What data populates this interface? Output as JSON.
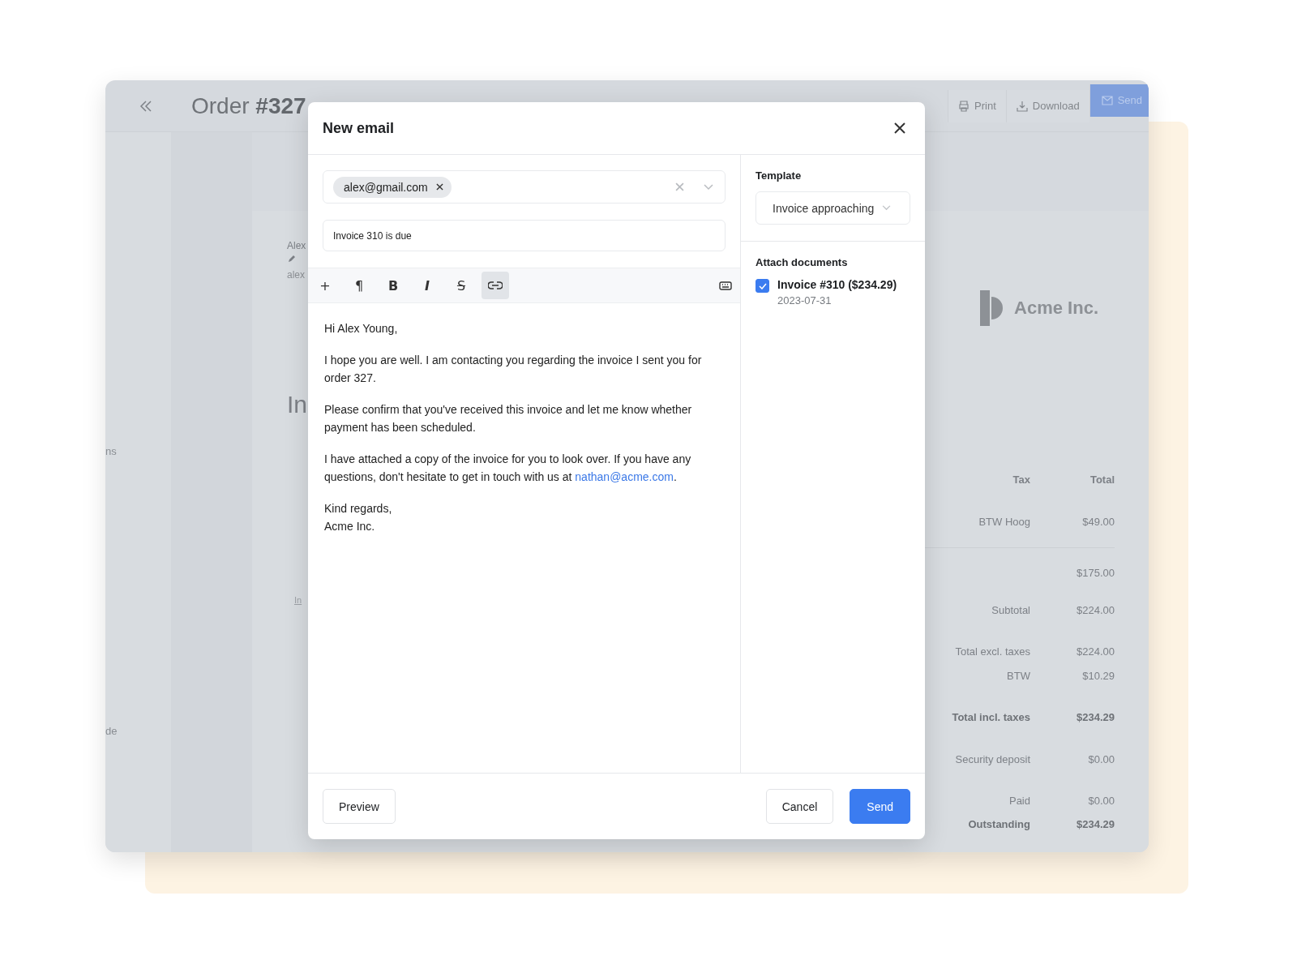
{
  "background": {
    "sidebar_fragments": [
      "ns",
      "de"
    ],
    "title": "Order **#327**",
    "actions": [
      {
        "label": "Print",
        "kind": "print"
      },
      {
        "label": "Download",
        "kind": "download"
      },
      {
        "label": "Send",
        "kind": "send"
      }
    ],
    "customer": {
      "name": "Alex",
      "email": "alex"
    },
    "heading": "In",
    "link": "In",
    "logo": "Acme Inc.",
    "table": {
      "columns": [
        "Tax",
        "Total"
      ],
      "rows": [
        {
          "tax": "BTW Hoog",
          "total": "$49.00"
        }
      ]
    },
    "totals": [
      {
        "value": "$175.00",
        "bold": false
      },
      {
        "label": "Subtotal",
        "value": "$224.00",
        "bold": false
      },
      {
        "label": "Total excl. taxes",
        "value": "$224.00",
        "bold": false
      },
      {
        "label": "BTW",
        "value": "$10.29",
        "bold": false
      },
      {
        "label": "Total incl. taxes",
        "value": "$234.29",
        "bold": true
      },
      {
        "label": "Security deposit",
        "value": "$0.00",
        "bold": false
      },
      {
        "label": "Paid",
        "value": "$0.00",
        "bold": false
      },
      {
        "label": "Outstanding",
        "value": "$234.29",
        "bold": true
      }
    ]
  },
  "email": {
    "title": "New email",
    "recipients": [
      "alex@gmail.com"
    ],
    "subject": "Invoice 310 is due",
    "toolbar": [
      {
        "kind": "text",
        "glyph": "+",
        "active": false
      },
      {
        "kind": "text",
        "glyph": "¶",
        "active": false
      },
      {
        "kind": "bold",
        "glyph": "B",
        "active": false
      },
      {
        "kind": "italic",
        "glyph": "I",
        "active": false
      },
      {
        "kind": "strike",
        "glyph": "S",
        "active": false
      },
      {
        "kind": "link",
        "active": true
      }
    ],
    "body": [
      {
        "text": "Hi Alex Young,"
      },
      {
        "text": "I hope you are well. I am contacting you regarding the invoice I sent you for order 327."
      },
      {
        "text": "Please confirm that you've received this invoice and let me know whether payment has been scheduled."
      },
      {
        "text": "I have attached a copy of the invoice for you to look over. If you have any questions, don't hesitate to get in touch with us at ",
        "link": "nathan@acme.com",
        "tail": "."
      },
      {
        "text": "Kind regards,\nAcme Inc."
      }
    ],
    "template": {
      "label": "Template",
      "value": "Invoice approaching"
    },
    "attachments": {
      "label": "Attach documents",
      "items": [
        {
          "name": "Invoice #310 ($234.29)",
          "date": "2023-07-31",
          "checked": true
        }
      ]
    },
    "footer": {
      "preview": "Preview",
      "cancel": "Cancel",
      "send": "Send"
    }
  }
}
